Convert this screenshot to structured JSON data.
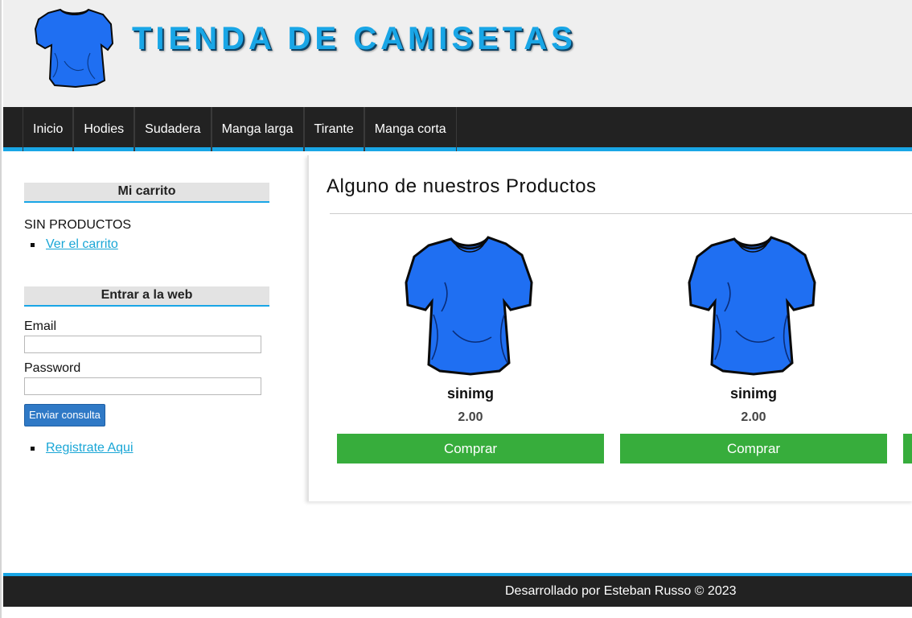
{
  "header": {
    "title": "TIENDA DE CAMISETAS",
    "logo_icon": "tshirt-icon"
  },
  "nav": {
    "items": [
      "Inicio",
      "Hodies",
      "Sudadera",
      "Manga larga",
      "Tirante",
      "Manga corta"
    ]
  },
  "sidebar": {
    "cart": {
      "title": "Mi carrito",
      "empty_text": "SIN PRODUCTOS",
      "view_cart_link": "Ver el carrito"
    },
    "login": {
      "title": "Entrar a la web",
      "email_label": "Email",
      "email_value": "",
      "password_label": "Password",
      "password_value": "",
      "submit_label": "Enviar consulta",
      "register_link": "Registrate Aqui"
    }
  },
  "main": {
    "title": "Alguno de nuestros Productos",
    "products": [
      {
        "name": "sinimg",
        "price": "2.00",
        "buy_label": "Comprar"
      },
      {
        "name": "sinimg",
        "price": "2.00",
        "buy_label": "Comprar"
      },
      {
        "name": "",
        "price": "",
        "buy_label": ""
      }
    ]
  },
  "footer": {
    "text": "Desarrollado por Esteban Russo © 2023"
  },
  "colors": {
    "accent": "#19a6e6",
    "nav_bg": "#222222",
    "buy_button": "#37ad3c",
    "shirt": "#1f6ff2"
  }
}
